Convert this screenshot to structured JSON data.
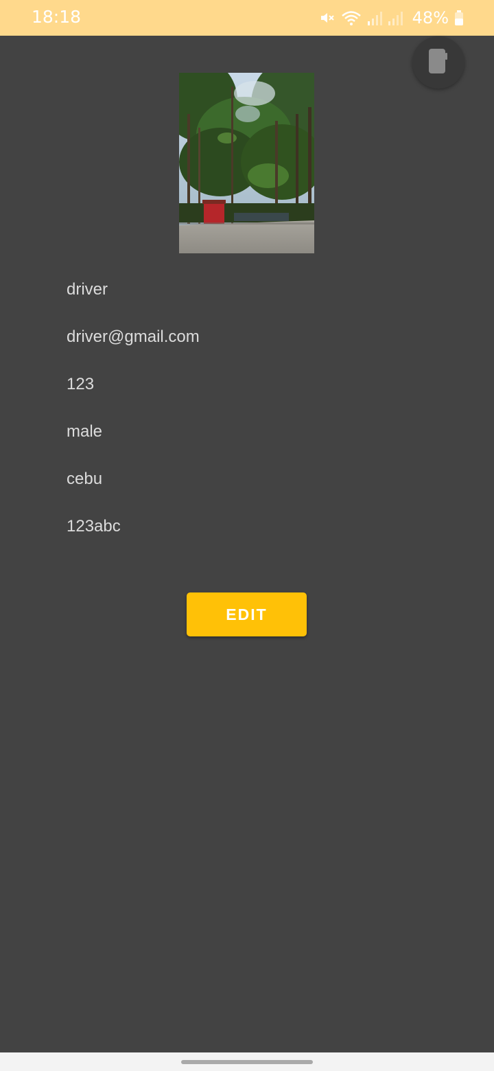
{
  "status_bar": {
    "time": "18:18",
    "battery": "48%",
    "icons": [
      "mute-icon",
      "wifi-icon",
      "signal-icon",
      "signal-icon",
      "battery-icon"
    ]
  },
  "floating_button": {
    "icon": "screen-rotate-icon"
  },
  "profile": {
    "photo": "forest-road-photo",
    "fields": [
      {
        "value": "driver"
      },
      {
        "value": "driver@gmail.com"
      },
      {
        "value": "123"
      },
      {
        "value": "male"
      },
      {
        "value": "cebu"
      },
      {
        "value": "123abc"
      }
    ]
  },
  "actions": {
    "edit_label": "EDIT"
  },
  "colors": {
    "status_bar": "#ffd98c",
    "background": "#434343",
    "accent": "#ffc107",
    "text": "#dcdcdc"
  }
}
